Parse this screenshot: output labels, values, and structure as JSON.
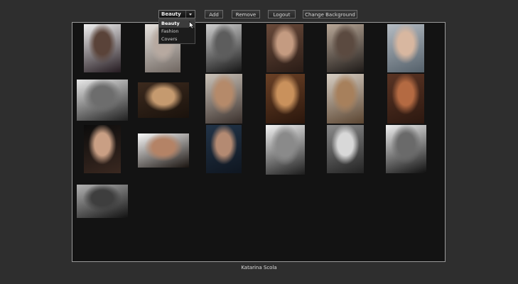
{
  "toolbar": {
    "category_select": {
      "selected": "Beauty",
      "options": [
        "Beauty",
        "Fashion",
        "Covers"
      ]
    },
    "add_label": "Add",
    "remove_label": "Remove",
    "logout_label": "Logout",
    "change_background_label": "Change Background"
  },
  "gallery": {
    "rows": [
      [
        {
          "name": "thumb-1-1",
          "colors": [
            "#f1f1f1",
            "#5a4339",
            "#241a20"
          ]
        },
        {
          "name": "thumb-1-2",
          "colors": [
            "#e7e3df",
            "#b7a9a0",
            "#6f6660"
          ]
        },
        {
          "name": "thumb-1-3",
          "colors": [
            "#cfcfcf",
            "#5d5d5d",
            "#161616"
          ]
        },
        {
          "name": "thumb-1-4",
          "colors": [
            "#6a4a3a",
            "#c49b81",
            "#2a1c16"
          ]
        },
        {
          "name": "thumb-1-5",
          "colors": [
            "#b9a898",
            "#5b4a40",
            "#1e1a18"
          ]
        },
        {
          "name": "thumb-1-6",
          "colors": [
            "#b5bcc3",
            "#d8b7a0",
            "#54606a"
          ]
        }
      ],
      [
        {
          "name": "thumb-2-1",
          "colors": [
            "#eaeaea",
            "#6d6d6d",
            "#202020"
          ]
        },
        {
          "name": "thumb-2-2",
          "colors": [
            "#3c2a1e",
            "#c59a6f",
            "#1a120c"
          ]
        },
        {
          "name": "thumb-2-3",
          "colors": [
            "#ccc4ba",
            "#b58a6a",
            "#3a302c"
          ]
        },
        {
          "name": "thumb-2-4",
          "colors": [
            "#6b4126",
            "#c9915c",
            "#2a160c"
          ]
        },
        {
          "name": "thumb-2-5",
          "colors": [
            "#d8cfc4",
            "#a7805c",
            "#5a4430"
          ]
        },
        {
          "name": "thumb-2-6",
          "colors": [
            "#5a3424",
            "#b46a42",
            "#2c1810"
          ]
        }
      ],
      [
        {
          "name": "thumb-3-1",
          "colors": [
            "#0c0c0c",
            "#c99f84",
            "#3a2820"
          ]
        },
        {
          "name": "thumb-3-2",
          "colors": [
            "#fbfbfb",
            "#b48366",
            "#1a1410"
          ]
        },
        {
          "name": "thumb-3-3",
          "colors": [
            "#223448",
            "#b48a72",
            "#0f1620"
          ]
        },
        {
          "name": "thumb-3-4",
          "colors": [
            "#f4f4f4",
            "#8a8a8a",
            "#1c1c1c"
          ]
        },
        {
          "name": "thumb-3-5",
          "colors": [
            "#8c8c8c",
            "#d8d8d8",
            "#222222"
          ]
        },
        {
          "name": "thumb-3-6",
          "colors": [
            "#f0f0f0",
            "#6a6a6a",
            "#101010"
          ]
        }
      ],
      [
        {
          "name": "thumb-4-1",
          "colors": [
            "#b4b4b4",
            "#3e3e3e",
            "#121212"
          ]
        }
      ]
    ]
  },
  "footer": {
    "caption": "Katarina Scola"
  }
}
